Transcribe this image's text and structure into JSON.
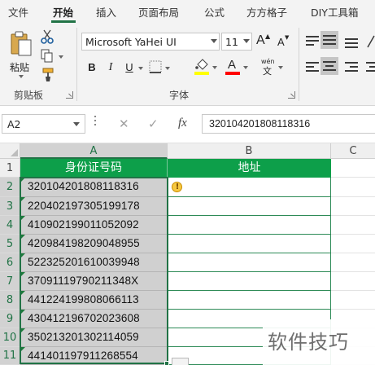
{
  "ribbon": {
    "tabs": [
      {
        "label": "文件"
      },
      {
        "label": "开始"
      },
      {
        "label": "插入"
      },
      {
        "label": "页面布局"
      },
      {
        "label": "公式"
      },
      {
        "label": "方方格子"
      },
      {
        "label": "DIY工具箱"
      }
    ],
    "active_tab": "开始",
    "clipboard": {
      "paste_label": "粘贴",
      "group_label": "剪贴板"
    },
    "font": {
      "font_name": "Microsoft YaHei UI",
      "font_size": "11",
      "grow_label": "A",
      "shrink_label": "A",
      "bold_label": "B",
      "italic_label": "I",
      "underline_label": "U",
      "font_color_label": "A",
      "phonetic_label": "wén",
      "group_label": "字体"
    },
    "colors": {
      "accent": "#217346",
      "fill_swatch": "#ffff00",
      "font_color_swatch": "#ff0000",
      "header_fill": "#0d9f4a",
      "selection_fill": "#d0d0d0"
    }
  },
  "formula_bar": {
    "name_box": "A2",
    "cancel_icon": "✕",
    "enter_icon": "✓",
    "insert_function_label": "fx",
    "formula": "320104201808118316"
  },
  "sheet": {
    "columns": [
      "A",
      "B",
      "C"
    ],
    "rows": [
      "1",
      "2",
      "3",
      "4",
      "5",
      "6",
      "7",
      "8",
      "9",
      "10",
      "11"
    ],
    "header_row": {
      "A": "身份证号码",
      "B": "地址"
    },
    "id_numbers": [
      "320104201808118316",
      "220402197305199178",
      "410902199011052092",
      "420984198209048955",
      "522325201610039948",
      "37091119790211348X",
      "441224199808066113",
      "430412196702023608",
      "350213201302114059",
      "441401197911268554"
    ],
    "warning_icon_label": "!"
  },
  "watermark": "软件技巧"
}
